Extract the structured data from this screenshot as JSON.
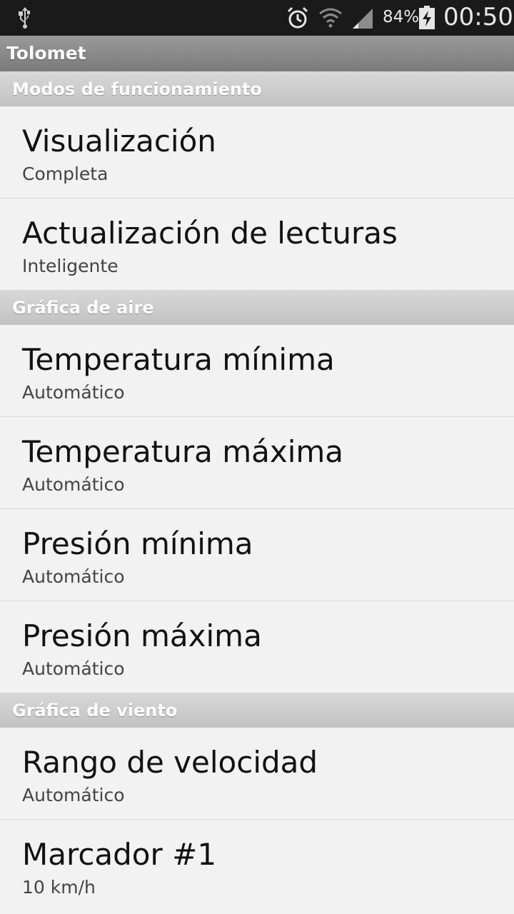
{
  "status_bar": {
    "battery_percent": "84%",
    "time": "00:50",
    "icons": [
      "usb-icon",
      "alarm-icon",
      "wifi-icon",
      "signal-icon",
      "battery-charging-icon"
    ]
  },
  "app_bar": {
    "title": "Tolomet"
  },
  "sections": [
    {
      "title": "Modos de funcionamiento",
      "items": [
        {
          "title": "Visualización",
          "summary": "Completa"
        },
        {
          "title": "Actualización de lecturas",
          "summary": "Inteligente"
        }
      ]
    },
    {
      "title": "Gráfica de aire",
      "items": [
        {
          "title": "Temperatura mínima",
          "summary": "Automático"
        },
        {
          "title": "Temperatura máxima",
          "summary": "Automático"
        },
        {
          "title": "Presión mínima",
          "summary": "Automático"
        },
        {
          "title": "Presión máxima",
          "summary": "Automático"
        }
      ]
    },
    {
      "title": "Gráfica de viento",
      "items": [
        {
          "title": "Rango de velocidad",
          "summary": "Automático"
        },
        {
          "title": "Marcador #1",
          "summary": "10 km/h"
        }
      ]
    }
  ]
}
